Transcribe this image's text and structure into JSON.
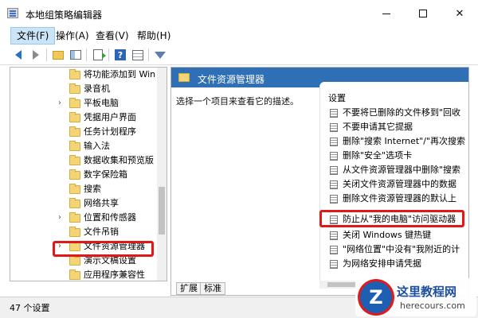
{
  "window": {
    "title": "本地组策略编辑器"
  },
  "menu": {
    "items": [
      "文件(F)",
      "操作(A)",
      "查看(V)",
      "帮助(H)"
    ]
  },
  "toolbar": {
    "icons": [
      "back-arrow-icon",
      "forward-arrow-icon",
      "folder-up-icon",
      "show-pane-icon",
      "export-list-icon",
      "help-icon",
      "properties-icon",
      "filter-icon"
    ],
    "help_glyph": "?"
  },
  "tree": {
    "items": [
      {
        "label": "将功能添加到 Win",
        "expandable": false
      },
      {
        "label": "录音机",
        "expandable": false
      },
      {
        "label": "平板电脑",
        "expandable": true
      },
      {
        "label": "凭据用户界面",
        "expandable": false
      },
      {
        "label": "任务计划程序",
        "expandable": false
      },
      {
        "label": "输入法",
        "expandable": false
      },
      {
        "label": "数据收集和预览版",
        "expandable": false
      },
      {
        "label": "数字保险箱",
        "expandable": false
      },
      {
        "label": "搜索",
        "expandable": false
      },
      {
        "label": "网络共享",
        "expandable": false
      },
      {
        "label": "位置和传感器",
        "expandable": true
      },
      {
        "label": "文件吊销",
        "expandable": false
      },
      {
        "label": "文件资源管理器",
        "expandable": true,
        "selected": true
      },
      {
        "label": "演示文稿设置",
        "expandable": false
      },
      {
        "label": "应用程序兼容性",
        "expandable": false
      }
    ],
    "chevron": "›"
  },
  "details": {
    "header": "文件资源管理器",
    "description": "选择一个项目来查看它的描述。",
    "settings_header": "设置",
    "settings": [
      "不要将已删除的文件移到\"回收",
      "不要申请其它提据",
      "删除\"搜索 Internet\"/\"再次搜索",
      "删除\"安全\"选项卡",
      "从文件资源管理器中删除\"搜索",
      "关闭文件资源管理器中的数据",
      "删除文件资源管理器的默认上",
      "防止从\"我的电脑\"访问驱动器",
      "关闭 Windows 键热键",
      "\"网络位置\"中没有\"我附近的计",
      "为网络安排申请凭据"
    ],
    "tabs": [
      "扩展",
      "标准"
    ]
  },
  "status": {
    "text": "47 个设置"
  },
  "watermark": {
    "cn": "这里教程网",
    "en": "herecours.com",
    "logo": "Z"
  },
  "colors": {
    "header": "#2f6fb6",
    "highlight": "#e01818",
    "selection": "#cce4f7"
  }
}
